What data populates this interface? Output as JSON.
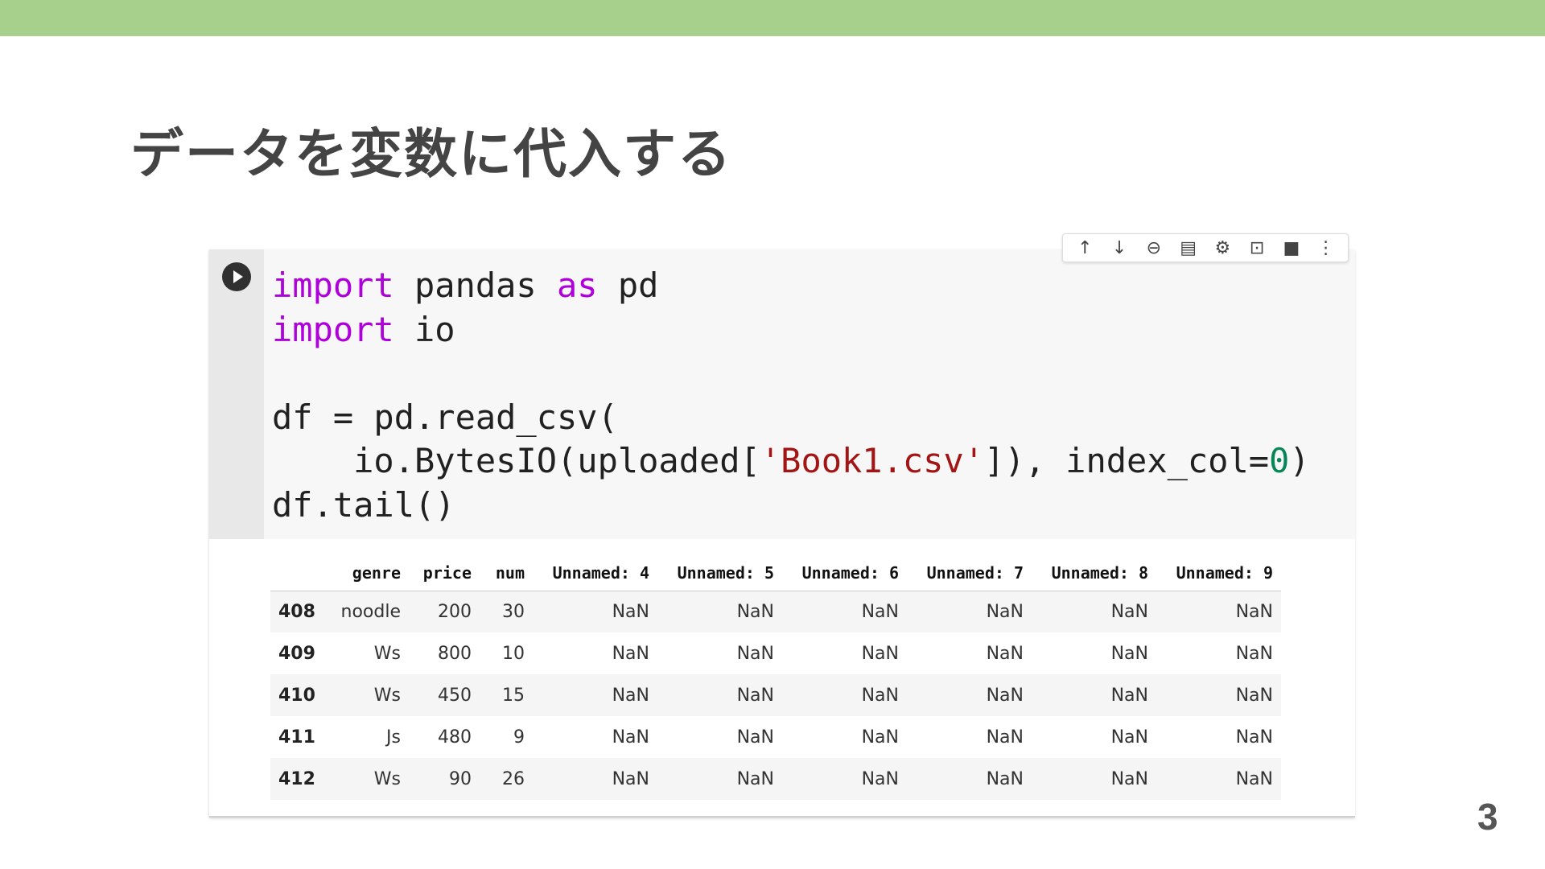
{
  "slide": {
    "title": "データを変数に代入する",
    "page_number": "3",
    "accent_color": "#a8d08d"
  },
  "cell": {
    "code_lines": [
      [
        {
          "t": "import",
          "c": "kw"
        },
        {
          "t": " pandas ",
          "c": ""
        },
        {
          "t": "as",
          "c": "kw"
        },
        {
          "t": " pd",
          "c": ""
        }
      ],
      [
        {
          "t": "import",
          "c": "kw"
        },
        {
          "t": " io",
          "c": ""
        }
      ],
      [
        {
          "t": "",
          "c": ""
        }
      ],
      [
        {
          "t": "df = pd.read_csv(",
          "c": ""
        }
      ],
      [
        {
          "t": "    io.BytesIO(uploaded[",
          "c": ""
        },
        {
          "t": "'Book1.csv'",
          "c": "str"
        },
        {
          "t": "]), index_col=",
          "c": ""
        },
        {
          "t": "0",
          "c": "num"
        },
        {
          "t": ")",
          "c": ""
        }
      ],
      [
        {
          "t": "df.tail()",
          "c": ""
        }
      ]
    ]
  },
  "toolbar": {
    "icons": [
      "arrow-up-icon",
      "arrow-down-icon",
      "link-icon",
      "comment-icon",
      "gear-icon",
      "mirror-cell-icon",
      "delete-icon",
      "more-vert-icon"
    ],
    "glyphs": [
      "↑",
      "↓",
      "⊖",
      "▤",
      "⚙",
      "⊡",
      "■",
      "⋮"
    ]
  },
  "table": {
    "columns": [
      "",
      "genre",
      "price",
      "num",
      "Unnamed: 4",
      "Unnamed: 5",
      "Unnamed: 6",
      "Unnamed: 7",
      "Unnamed: 8",
      "Unnamed: 9"
    ],
    "rows": [
      [
        "408",
        "noodle",
        "200",
        "30",
        "NaN",
        "NaN",
        "NaN",
        "NaN",
        "NaN",
        "NaN"
      ],
      [
        "409",
        "Ws",
        "800",
        "10",
        "NaN",
        "NaN",
        "NaN",
        "NaN",
        "NaN",
        "NaN"
      ],
      [
        "410",
        "Ws",
        "450",
        "15",
        "NaN",
        "NaN",
        "NaN",
        "NaN",
        "NaN",
        "NaN"
      ],
      [
        "411",
        "Js",
        "480",
        "9",
        "NaN",
        "NaN",
        "NaN",
        "NaN",
        "NaN",
        "NaN"
      ],
      [
        "412",
        "Ws",
        "90",
        "26",
        "NaN",
        "NaN",
        "NaN",
        "NaN",
        "NaN",
        "NaN"
      ]
    ]
  }
}
